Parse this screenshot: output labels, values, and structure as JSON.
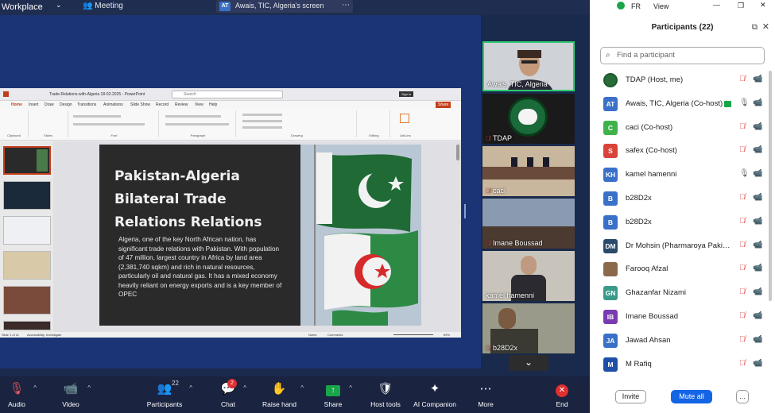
{
  "topbar": {
    "app_name": "Workplace",
    "meeting_label": "Meeting",
    "share_initials": "AT",
    "share_text": "Awais, TIC, Algeria's screen",
    "language": "FR",
    "view_label": "View"
  },
  "powerpoint": {
    "doc_title": "Trade-Relations-with-Algeria 18-02-2025 - PowerPoint",
    "search_placeholder": "Search",
    "signin_label": "Sign in",
    "share_label": "Share",
    "menu": [
      "Home",
      "Insert",
      "Draw",
      "Design",
      "Transitions",
      "Animations",
      "Slide Show",
      "Record",
      "Review",
      "View",
      "Help"
    ],
    "ribbon_groups": [
      "Clipboard",
      "Slides",
      "Font",
      "Paragraph",
      "Drawing",
      "Editing",
      "Add-ins"
    ],
    "slide_title": "Pakistan-Algeria Bilateral Trade Relations Relations",
    "slide_body": "Algeria, one of the key North African nation, has significant trade relations with Pakistan. With population of 47 million, largest country in Africa by land area (2,381,740 sqkm) and rich in natural resources, particularly oil and natural gas. It has a mixed economy heavily reliant on energy exports and is a key member of OPEC",
    "status_slide": "Slide 1 of 11",
    "status_access": "Accessibility: Investigate",
    "status_notes": "Notes",
    "status_comments": "Comments",
    "zoom": "69%"
  },
  "videos": [
    {
      "name": "Awais, TIC, Algeria",
      "muted": false
    },
    {
      "name": "TDAP",
      "muted": true
    },
    {
      "name": "caci",
      "muted": true
    },
    {
      "name": "Imane Boussad",
      "muted": true
    },
    {
      "name": "kamel hamenni",
      "muted": false
    },
    {
      "name": "b28D2x",
      "muted": true
    }
  ],
  "participants": {
    "title": "Participants (22)",
    "search_placeholder": "Find a participant",
    "list": [
      {
        "initials": "",
        "name": "TDAP (Host, me)",
        "color": "#2a6b3a"
      },
      {
        "initials": "AT",
        "name": "Awais, TIC, Algeria (Co-host)",
        "color": "#3a70c8"
      },
      {
        "initials": "C",
        "name": "caci (Co-host)",
        "color": "#3fb34a"
      },
      {
        "initials": "S",
        "name": "safex (Co-host)",
        "color": "#d9433a"
      },
      {
        "initials": "KH",
        "name": "kamel hamenni",
        "color": "#3a70c8"
      },
      {
        "initials": "B",
        "name": "b28D2x",
        "color": "#3a70c8"
      },
      {
        "initials": "B",
        "name": "b28D2x",
        "color": "#3a70c8"
      },
      {
        "initials": "DM",
        "name": "Dr Mohsin (Pharmaroya Pakist...",
        "color": "#2a4a6a"
      },
      {
        "initials": "",
        "name": "Farooq Afzal",
        "color": "#8a6a4a"
      },
      {
        "initials": "GN",
        "name": "Ghazanfar Nizami",
        "color": "#3a9a8a"
      },
      {
        "initials": "IB",
        "name": "Imane Boussad",
        "color": "#7a3ab0"
      },
      {
        "initials": "JA",
        "name": "Jawad Ahsan",
        "color": "#3a70c8"
      },
      {
        "initials": "M",
        "name": "M Rafiq",
        "color": "#1f4fa8"
      }
    ],
    "invite_label": "Invite",
    "mute_all_label": "Mute all",
    "more_label": "..."
  },
  "toolbar": {
    "audio": "Audio",
    "video": "Video",
    "participants": "Participants",
    "participants_count": "22",
    "chat": "Chat",
    "chat_badge": "2",
    "raise_hand": "Raise hand",
    "share": "Share",
    "host_tools": "Host tools",
    "ai_companion": "AI Companion",
    "more": "More",
    "end": "End"
  },
  "colors": {
    "stage_bg": "#1b3475",
    "toolbar_bg": "#1a2340",
    "accent_blue": "#1464e6",
    "muted_red": "#e25858",
    "active_green": "#2ecc71"
  }
}
